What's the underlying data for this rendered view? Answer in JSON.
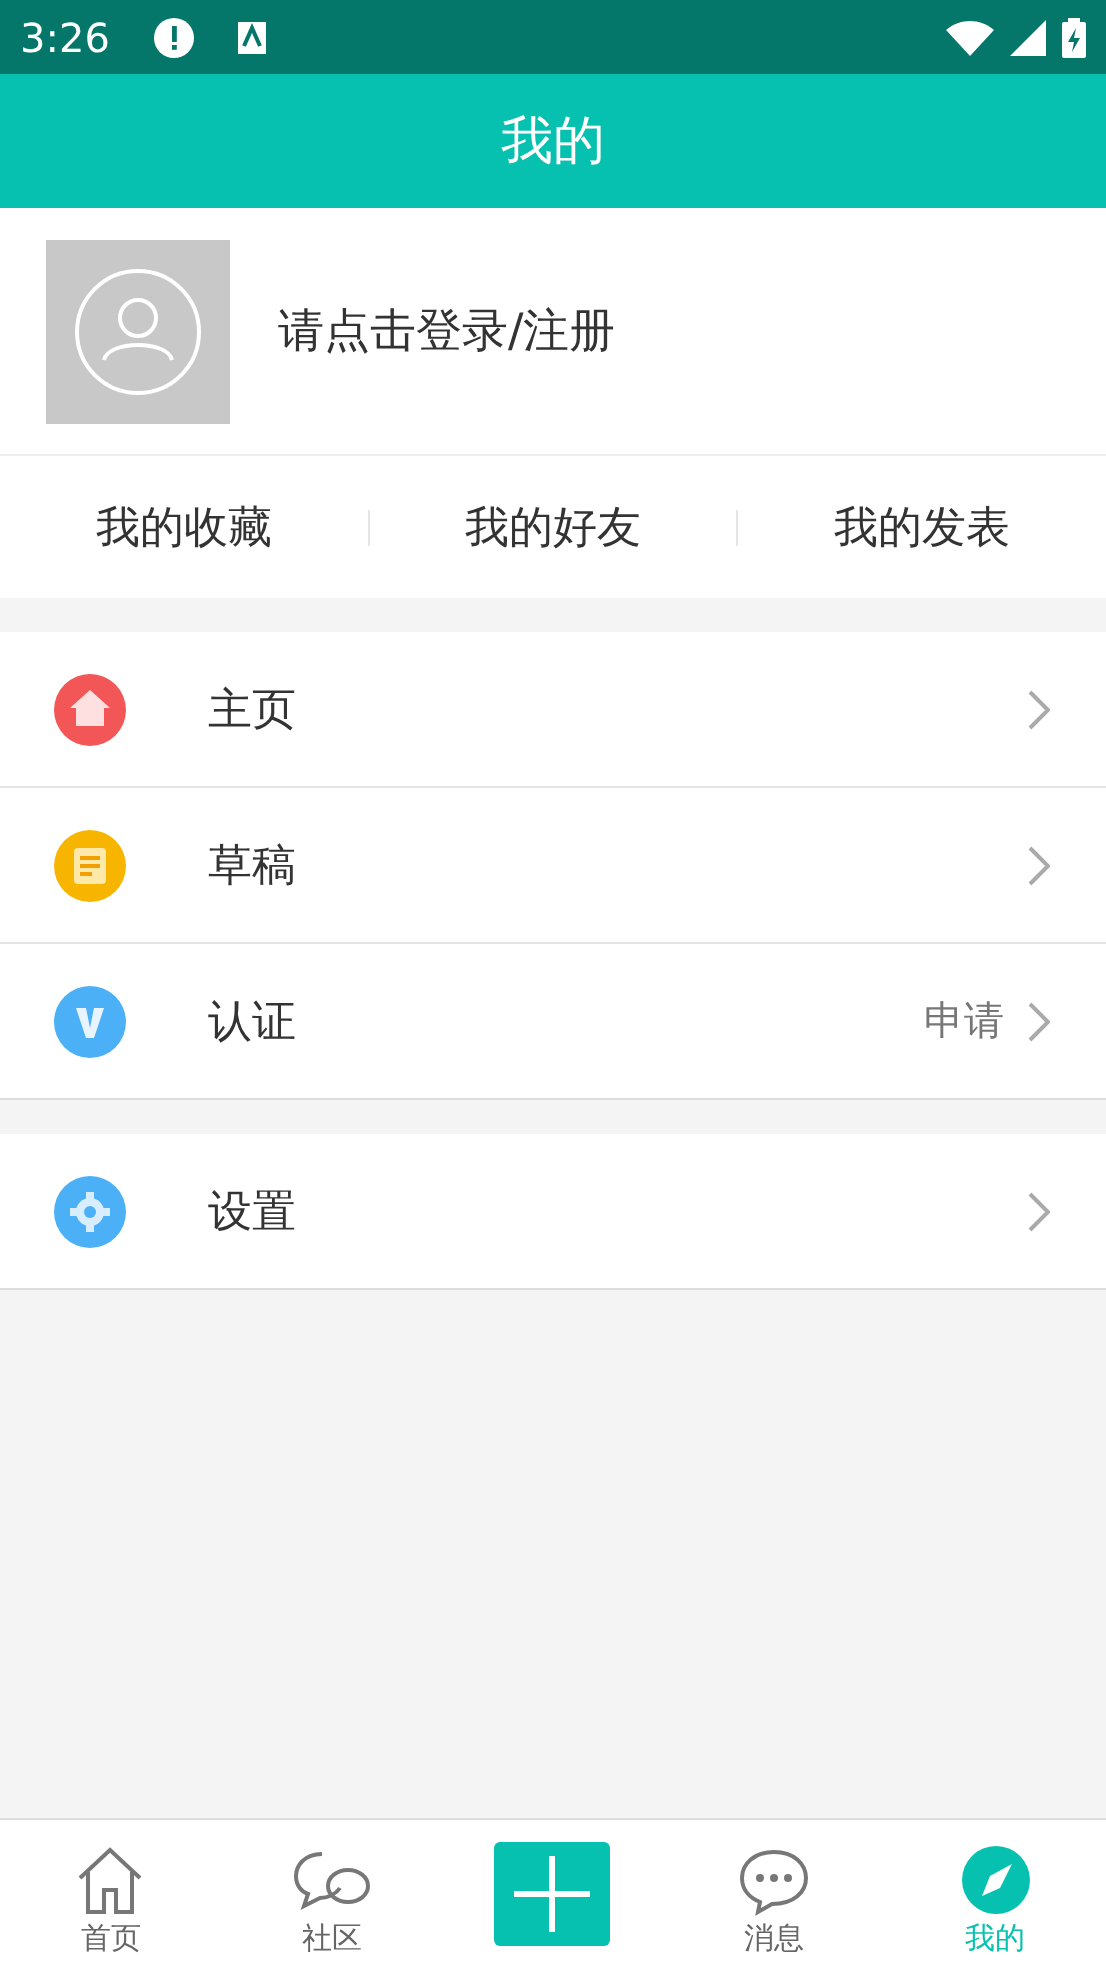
{
  "status_bar": {
    "time": "3:26"
  },
  "header": {
    "title": "我的"
  },
  "profile": {
    "login_prompt": "请点击登录/注册"
  },
  "shortcuts": [
    "我的收藏",
    "我的好友",
    "我的发表"
  ],
  "menu_groups": [
    {
      "items": [
        {
          "kind": "home",
          "label": "主页"
        },
        {
          "kind": "draft",
          "label": "草稿"
        },
        {
          "kind": "verify",
          "label": "认证",
          "detail": "申请"
        }
      ]
    },
    {
      "items": [
        {
          "kind": "settings",
          "label": "设置"
        }
      ]
    }
  ],
  "tab_bar": [
    {
      "kind": "home",
      "label": "首页",
      "selected": false
    },
    {
      "kind": "community",
      "label": "社区",
      "selected": false
    },
    {
      "kind": "add"
    },
    {
      "kind": "messages",
      "label": "消息",
      "selected": false
    },
    {
      "kind": "me",
      "label": "我的",
      "selected": true
    }
  ]
}
